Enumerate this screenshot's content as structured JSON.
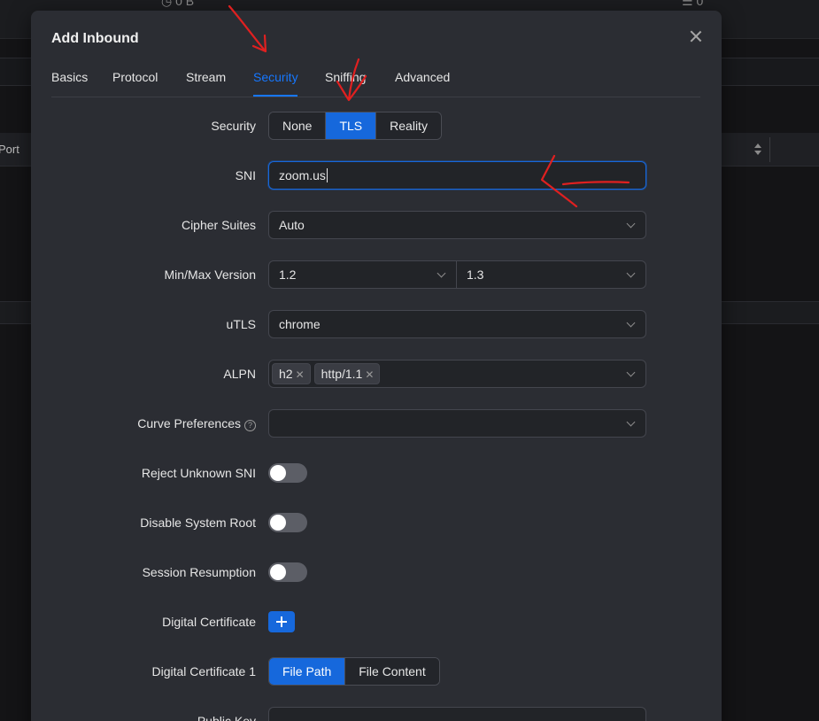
{
  "background": {
    "top_left_text": "◷ 0 B",
    "top_right_text": "☰ 0",
    "column_header": "Port"
  },
  "modal": {
    "title": "Add Inbound",
    "tabs": [
      {
        "label": "Basics"
      },
      {
        "label": "Protocol"
      },
      {
        "label": "Stream"
      },
      {
        "label": "Security"
      },
      {
        "label": "Sniffing"
      },
      {
        "label": "Advanced"
      }
    ],
    "active_tab": "Security"
  },
  "form": {
    "security": {
      "label": "Security",
      "options": [
        "None",
        "TLS",
        "Reality"
      ],
      "selected": "TLS"
    },
    "sni": {
      "label": "SNI",
      "value": "zoom.us"
    },
    "cipher_suites": {
      "label": "Cipher Suites",
      "value": "Auto"
    },
    "min_max_version": {
      "label": "Min/Max Version",
      "min": "1.2",
      "max": "1.3"
    },
    "utls": {
      "label": "uTLS",
      "value": "chrome"
    },
    "alpn": {
      "label": "ALPN",
      "tags": [
        "h2",
        "http/1.1"
      ]
    },
    "curve_preferences": {
      "label": "Curve Preferences",
      "value": ""
    },
    "reject_unknown_sni": {
      "label": "Reject Unknown SNI",
      "enabled": false
    },
    "disable_system_root": {
      "label": "Disable System Root",
      "enabled": false
    },
    "session_resumption": {
      "label": "Session Resumption",
      "enabled": false
    },
    "digital_certificate": {
      "label": "Digital Certificate"
    },
    "digital_certificate_1": {
      "label": "Digital Certificate 1",
      "options": [
        "File Path",
        "File Content"
      ],
      "selected": "File Path"
    },
    "public_key": {
      "label": "Public Key"
    }
  },
  "colors": {
    "accent": "#1668dc",
    "annotation": "#e02020"
  }
}
